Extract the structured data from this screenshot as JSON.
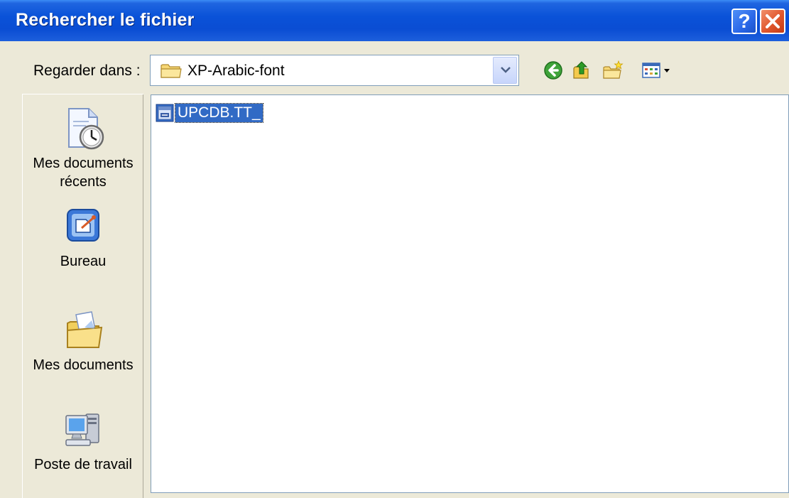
{
  "window": {
    "title": "Rechercher le fichier",
    "help_label": "?",
    "close_label": "✕"
  },
  "lookin": {
    "label": "Regarder dans :",
    "value": "XP-Arabic-font"
  },
  "toolbar": {
    "icons": [
      "back-icon",
      "up-folder-icon",
      "new-folder-icon",
      "view-menu-icon"
    ]
  },
  "places": [
    {
      "label": "Mes documents récents",
      "icon": "recent-documents-icon"
    },
    {
      "label": "Bureau",
      "icon": "desktop-icon"
    },
    {
      "label": "Mes documents",
      "icon": "my-documents-icon"
    },
    {
      "label": "Poste de travail",
      "icon": "my-computer-icon"
    }
  ],
  "files": [
    {
      "name": "UPCDB.TT_",
      "selected": true,
      "icon": "font-file-icon"
    }
  ],
  "colors": {
    "titlebar": "#0a52d8",
    "selection": "#316ac5",
    "dialog_bg": "#ece9d8"
  }
}
